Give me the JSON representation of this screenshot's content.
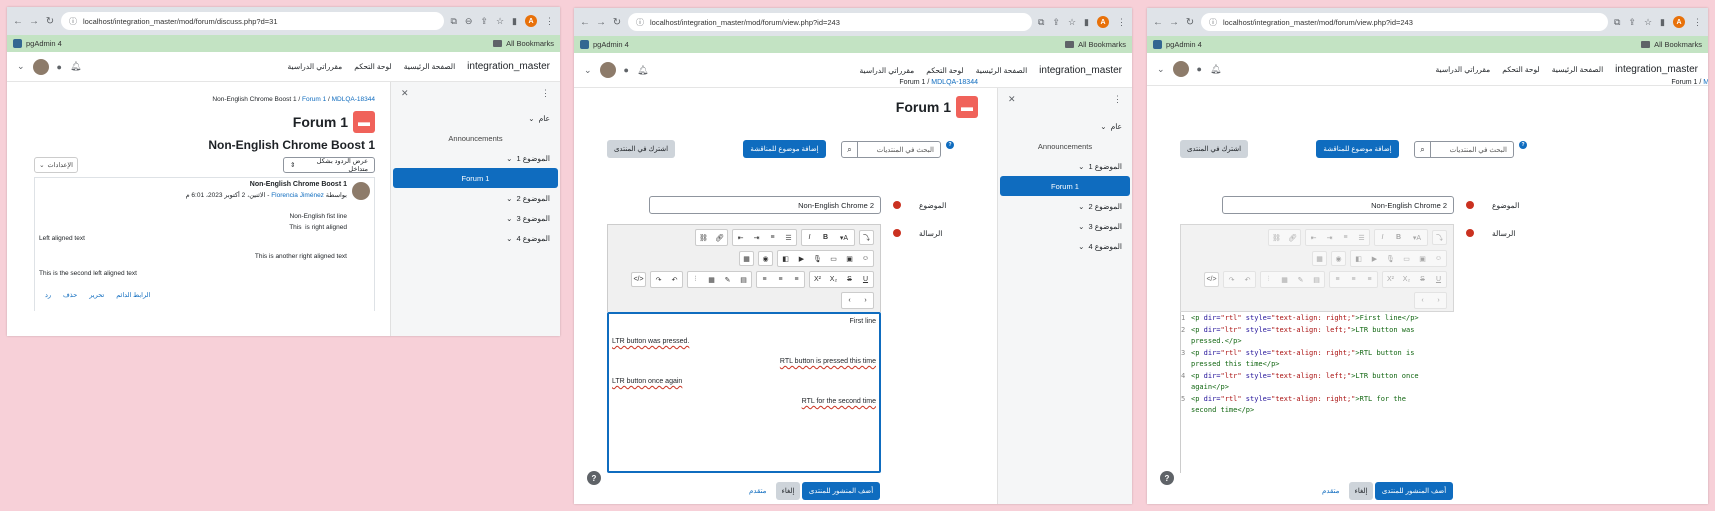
{
  "common": {
    "pgadmin": "pgAdmin 4",
    "all_bookmarks": "All Bookmarks",
    "brand": "integration_master",
    "nav_home": "الصفحة الرئيسية",
    "nav_dashboard": "لوحة التحكم",
    "nav_courses": "مقرراتي الدراسية",
    "forum_title": "Forum 1",
    "forum_link": "MDLQA-18344",
    "drawer": {
      "general": "عام",
      "announcements": "Announcements",
      "topic1": "الموضوع 1",
      "forum1": "Forum 1",
      "topic2": "الموضوع 2",
      "topic3": "الموضوع 3",
      "topic4": "الموضوع 4"
    }
  },
  "w1": {
    "url": "localhost/integration_master/mod/forum/discuss.php?d=31",
    "breadcrumb_course": "Non-English Chrome Boost 1",
    "discussion_title": "Non-English Chrome Boost 1",
    "settings": "الإعدادات",
    "display_mode": "عرض الردود بشكل متداخل",
    "post": {
      "subject": "Non-English Chrome Boost 1",
      "byline_prefix": "بواسطة",
      "author": "Florencia Jiménez",
      "byline_date": "- الاثنين، 2 أكتوبر 2023، 6:01 م",
      "lines": [
        "Non-English fist line",
        "This  is right aligned",
        "Left aligned text",
        "This is another right aligned text",
        "This is the second left aligned text"
      ],
      "actions": [
        "الرابط الدائم",
        "تحرير",
        "حذف",
        "رد"
      ]
    }
  },
  "w2": {
    "url": "localhost/integration_master/mod/forum/view.php?id=243",
    "subscribe": "اشترك في المنتدى",
    "add_topic": "إضافة موضوع للمناقشة",
    "search_placeholder": "البحث في المنتديات",
    "subject_label": "الموضوع",
    "subject_value": "Non-English Chrome 2",
    "message_label": "الرسالة",
    "editor_lines": [
      "First line",
      "LTR button was pressed.",
      "RTL button is pressed this time",
      "LTR button once again",
      "RTL for the second time"
    ],
    "post_button": "أضف المنشور للمنتدى",
    "cancel": "إلغاء",
    "advanced": "متقدم"
  },
  "w3": {
    "url": "localhost/integration_master/mod/forum/view.php?id=243",
    "subscribe": "اشترك في المنتدى",
    "add_topic": "إضافة موضوع للمناقشة",
    "search_placeholder": "البحث في المنتديات",
    "subject_label": "الموضوع",
    "subject_value": "Non-English Chrome 2",
    "message_label": "الرسالة",
    "code": {
      "l1": [
        "1",
        "<p",
        " dir=",
        "\"rtl\"",
        " style=",
        "\"text-align: right;\"",
        ">First line</p>"
      ],
      "l2a": [
        "2",
        "<p",
        " dir=",
        "\"ltr\"",
        " style=",
        "\"text-align: left;\"",
        ">LTR button was"
      ],
      "l2b": "pressed.</p>",
      "l3a": [
        "3",
        "<p",
        " dir=",
        "\"rtl\"",
        " style=",
        "\"text-align: right;\"",
        ">RTL button is"
      ],
      "l3b": "pressed this time</p>",
      "l4a": [
        "4",
        "<p",
        " dir=",
        "\"ltr\"",
        " style=",
        "\"text-align: left;\"",
        ">LTR button once"
      ],
      "l4b": "again</p>",
      "l5a": [
        "5",
        "<p",
        " dir=",
        "\"rtl\"",
        " style=",
        "\"text-align: right;\"",
        ">RTL for the"
      ],
      "l5b": "second time</p>"
    },
    "post_button": "أضف المنشور للمنتدى",
    "cancel": "إلغاء",
    "advanced": "متقدم"
  },
  "colors": {
    "primary": "#0f6cbf",
    "forum_icon": "#f0625a",
    "bookmarks_bar": "#c3e3c3",
    "background": "#f7d0d8",
    "required": "#ca3120"
  }
}
